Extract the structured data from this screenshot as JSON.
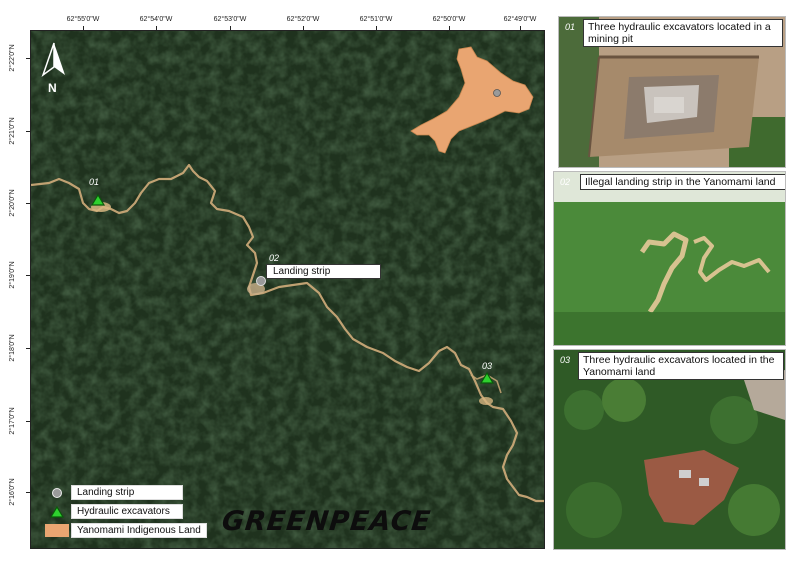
{
  "map": {
    "top_ticks": [
      "62°55'0\"W",
      "62°54'0\"W",
      "62°53'0\"W",
      "62°52'0\"W",
      "62°51'0\"W",
      "62°50'0\"W",
      "62°49'0\"W"
    ],
    "left_ticks": [
      "2°22'0\"N",
      "2°21'0\"N",
      "2°20'0\"N",
      "2°19'0\"N",
      "2°18'0\"N",
      "2°17'0\"N",
      "2°16'0\"N"
    ],
    "north_label": "N",
    "sites": {
      "s01_num": "01",
      "s02_num": "02",
      "s02_label": "Landing strip",
      "s03_num": "03"
    },
    "legend": {
      "landing_strip": "Landing strip",
      "excavators": "Hydraulic excavators",
      "indigenous_land": "Yanomami Indigenous Land"
    },
    "logo": "GREENPEACE",
    "colors": {
      "forest": "#1e2f1d",
      "river": "#d9b784",
      "indigenous_land": "#e9a571",
      "excavator": "#2ed12e",
      "landing": "#9a9a9a"
    }
  },
  "photos": [
    {
      "num": "01",
      "caption": "Three hydraulic excavators located in a mining pit"
    },
    {
      "num": "02",
      "caption": "Illegal landing strip in the Yanomami land"
    },
    {
      "num": "03",
      "caption": "Three hydraulic excavators located in the Yanomami land"
    }
  ]
}
